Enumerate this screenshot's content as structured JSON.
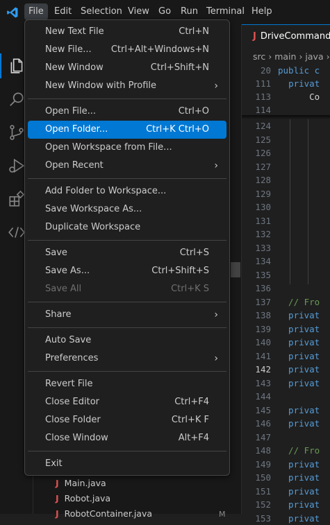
{
  "menubar": {
    "items": [
      "File",
      "Edit",
      "Selection",
      "View",
      "Go",
      "Run",
      "Terminal",
      "Help"
    ]
  },
  "colors": {
    "accent": "#0078d4",
    "menu_bg": "#1f1f1f",
    "java_icon": "#e05252",
    "keyword": "#569cd6",
    "comment": "#6a9955"
  },
  "activity_icons": [
    "explorer-icon",
    "search-icon",
    "source-control-icon",
    "run-debug-icon",
    "extensions-icon",
    "remote-explorer-icon"
  ],
  "file_menu": {
    "groups": [
      [
        {
          "label": "New Text File",
          "shortcut": "Ctrl+N"
        },
        {
          "label": "New File...",
          "shortcut": "Ctrl+Alt+Windows+N"
        },
        {
          "label": "New Window",
          "shortcut": "Ctrl+Shift+N"
        },
        {
          "label": "New Window with Profile",
          "submenu": true
        }
      ],
      [
        {
          "label": "Open File...",
          "shortcut": "Ctrl+O"
        },
        {
          "label": "Open Folder...",
          "shortcut": "Ctrl+K Ctrl+O",
          "selected": true
        },
        {
          "label": "Open Workspace from File..."
        },
        {
          "label": "Open Recent",
          "submenu": true
        }
      ],
      [
        {
          "label": "Add Folder to Workspace..."
        },
        {
          "label": "Save Workspace As..."
        },
        {
          "label": "Duplicate Workspace"
        }
      ],
      [
        {
          "label": "Save",
          "shortcut": "Ctrl+S"
        },
        {
          "label": "Save As...",
          "shortcut": "Ctrl+Shift+S"
        },
        {
          "label": "Save All",
          "shortcut": "Ctrl+K S",
          "disabled": true
        }
      ],
      [
        {
          "label": "Share",
          "submenu": true
        }
      ],
      [
        {
          "label": "Auto Save"
        },
        {
          "label": "Preferences",
          "submenu": true
        }
      ],
      [
        {
          "label": "Revert File"
        },
        {
          "label": "Close Editor",
          "shortcut": "Ctrl+F4"
        },
        {
          "label": "Close Folder",
          "shortcut": "Ctrl+K F"
        },
        {
          "label": "Close Window",
          "shortcut": "Alt+F4"
        }
      ],
      [
        {
          "label": "Exit"
        }
      ]
    ]
  },
  "sidebar": {
    "files": [
      "Main.java",
      "Robot.java",
      "RobotContainer.java"
    ],
    "badge": "M"
  },
  "editor": {
    "tab": "DriveCommands",
    "breadcrumb": [
      "src",
      "main",
      "java"
    ],
    "sticky": [
      {
        "n": "20",
        "code": [
          [
            "kw",
            "public c"
          ]
        ]
      },
      {
        "n": "111",
        "code": [
          [
            "plain",
            "  "
          ],
          [
            "kw",
            "privat"
          ]
        ]
      },
      {
        "n": "113",
        "code": [
          [
            "plain",
            "      Co"
          ]
        ]
      },
      {
        "n": "114",
        "code": []
      }
    ],
    "current_line": "142",
    "lines": [
      {
        "n": "124",
        "code": []
      },
      {
        "n": "125",
        "code": []
      },
      {
        "n": "126",
        "code": []
      },
      {
        "n": "127",
        "code": []
      },
      {
        "n": "128",
        "code": []
      },
      {
        "n": "129",
        "code": []
      },
      {
        "n": "130",
        "code": []
      },
      {
        "n": "131",
        "code": []
      },
      {
        "n": "132",
        "code": []
      },
      {
        "n": "133",
        "code": []
      },
      {
        "n": "134",
        "code": []
      },
      {
        "n": "135",
        "code": []
      },
      {
        "n": "136",
        "code": []
      },
      {
        "n": "137",
        "code": [
          [
            "cm",
            "  // Fro"
          ]
        ]
      },
      {
        "n": "138",
        "code": [
          [
            "kw",
            "  privat"
          ]
        ]
      },
      {
        "n": "139",
        "code": [
          [
            "kw",
            "  privat"
          ]
        ]
      },
      {
        "n": "140",
        "code": [
          [
            "kw",
            "  privat"
          ]
        ]
      },
      {
        "n": "141",
        "code": [
          [
            "kw",
            "  privat"
          ]
        ]
      },
      {
        "n": "142",
        "code": [
          [
            "kw",
            "  privat"
          ]
        ]
      },
      {
        "n": "143",
        "code": [
          [
            "kw",
            "  privat"
          ]
        ]
      },
      {
        "n": "144",
        "code": []
      },
      {
        "n": "145",
        "code": [
          [
            "kw",
            "  privat"
          ]
        ]
      },
      {
        "n": "146",
        "code": [
          [
            "kw",
            "  privat"
          ]
        ]
      },
      {
        "n": "147",
        "code": []
      },
      {
        "n": "148",
        "code": [
          [
            "cm",
            "  // Fro"
          ]
        ]
      },
      {
        "n": "149",
        "code": [
          [
            "kw",
            "  privat"
          ]
        ]
      },
      {
        "n": "150",
        "code": [
          [
            "kw",
            "  privat"
          ]
        ]
      },
      {
        "n": "151",
        "code": [
          [
            "kw",
            "  privat"
          ]
        ]
      },
      {
        "n": "152",
        "code": [
          [
            "kw",
            "  privat"
          ]
        ]
      },
      {
        "n": "153",
        "code": [
          [
            "kw",
            "  privat"
          ]
        ]
      }
    ]
  }
}
